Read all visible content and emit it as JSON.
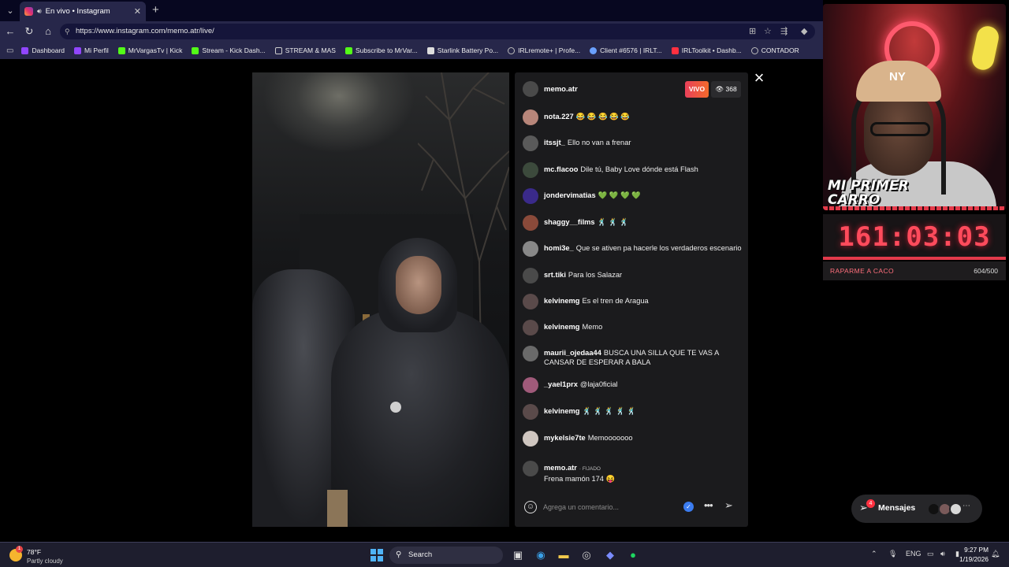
{
  "browser": {
    "tab": {
      "title": "En vivo • Instagram"
    },
    "url": "https://www.instagram.com/memo.atr/live/",
    "bookmarks": [
      {
        "label": "Dashboard",
        "color": "#9146ff"
      },
      {
        "label": "Mi Perfil",
        "color": "#9146ff"
      },
      {
        "label": "MrVargasTv | Kick",
        "color": "#53fc18"
      },
      {
        "label": "Stream - Kick Dash...",
        "color": "#53fc18"
      },
      {
        "label": "STREAM & MAS",
        "color": "#cccccc"
      },
      {
        "label": "Subscribe to MrVar...",
        "color": "#53fc18"
      },
      {
        "label": "Starlink Battery Po...",
        "color": "#dddddd"
      },
      {
        "label": "IRLremote+ | Profe...",
        "color": "#bbbbbb"
      },
      {
        "label": "Client #6576 | IRLT...",
        "color": "#6aa0ff"
      },
      {
        "label": "IRLToolkit • Dashb...",
        "color": "#ff3040"
      },
      {
        "label": "CONTADOR",
        "color": "#bbbbbb"
      }
    ]
  },
  "live": {
    "host": "memo.atr",
    "live_label": "VIVO",
    "viewer_count": "368",
    "close_label": "×"
  },
  "comments": [
    {
      "user": "nota.227",
      "text": "😂 😂 😂 😂 😂",
      "avatar_color": "#b8867a"
    },
    {
      "user": "itssjt_",
      "text": "Ello no van a frenar",
      "avatar_color": "#5a5a5a"
    },
    {
      "user": "mc.flacoo",
      "text": "Dile tú, Baby Love dónde está Flash",
      "avatar_color": "#3c4a3c"
    },
    {
      "user": "jondervimatias",
      "text": "💚 💚 💚 💚",
      "avatar_color": "#3a2a8a"
    },
    {
      "user": "shaggy__films",
      "text": "🕺 🕺 🕺",
      "avatar_color": "#8a4a3a"
    },
    {
      "user": "homi3e_",
      "text": "Que se ativen pa hacerle los verdaderos escenario",
      "avatar_color": "#888888"
    },
    {
      "user": "srt.tiki",
      "text": "Para los Salazar",
      "avatar_color": "#4a4a4a"
    },
    {
      "user": "kelvinemg",
      "text": "Es el tren de Aragua",
      "avatar_color": "#5a4a4a"
    },
    {
      "user": "kelvinemg",
      "text": "Memo",
      "avatar_color": "#5a4a4a"
    },
    {
      "user": "maurii_ojedaa44",
      "text": "BUSCA UNA SILLA QUE TE VAS A CANSAR DE ESPERAR A BALA",
      "avatar_color": "#6a6a6a"
    },
    {
      "user": "_yael1prx",
      "text": "@laja0ficial",
      "avatar_color": "#a05a7a"
    },
    {
      "user": "kelvinemg",
      "text": "🕺 🕺 🕺 🕺 🕺",
      "avatar_color": "#5a4a4a"
    },
    {
      "user": "mykelsie7te",
      "text": "Memooooooo",
      "avatar_color": "#cfc6c0"
    }
  ],
  "pinned": {
    "user": "memo.atr",
    "tag": "· FIJADO",
    "text": "Frena mamón 174 😝"
  },
  "composer": {
    "placeholder": "Agrega un comentario..."
  },
  "messages": {
    "label": "Mensajes",
    "badge": "4"
  },
  "overlay": {
    "title": "MI PRIMER CARRO",
    "timer": "161:03:03",
    "goal_label": "RAPARME A CACO",
    "goal_count": "604/500"
  },
  "taskbar": {
    "temp": "78°F",
    "condition": "Partly cloudy",
    "search_label": "Search",
    "lang": "ENG",
    "time": "9:27 PM",
    "date": "1/19/2026",
    "weather_badge": "1"
  },
  "colors": {
    "live_gradient": [
      "#e9405a",
      "#f26a2b"
    ],
    "timer_red": "#ff4b5c",
    "chat_bg": "#1b1b1d"
  }
}
